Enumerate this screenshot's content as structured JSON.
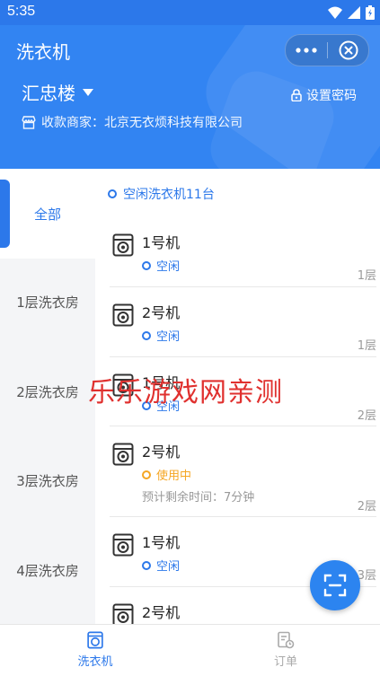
{
  "status_bar": {
    "time": "5:35"
  },
  "header": {
    "title": "洗衣机",
    "building": "汇忠楼",
    "set_password": "设置密码",
    "merchant": "收款商家：北京无衣烦科技有限公司"
  },
  "sidebar": {
    "items": [
      {
        "label": "全部",
        "active": true
      },
      {
        "label": "1层洗衣房"
      },
      {
        "label": "2层洗衣房"
      },
      {
        "label": "3层洗衣房"
      },
      {
        "label": "4层洗衣房"
      }
    ]
  },
  "content": {
    "summary": "空闲洗衣机11台",
    "machines": [
      {
        "name": "1号机",
        "status": "空闲",
        "floor": "1层"
      },
      {
        "name": "2号机",
        "status": "空闲",
        "floor": "1层"
      },
      {
        "name": "1号机",
        "status": "空闲",
        "floor": "2层"
      },
      {
        "name": "2号机",
        "status": "使用中",
        "remain": "预计剩余时间：7分钟",
        "floor": "2层"
      },
      {
        "name": "1号机",
        "status": "空闲",
        "floor": "3层"
      },
      {
        "name": "2号机"
      }
    ]
  },
  "watermark": "乐乐游戏网亲测",
  "tabbar": {
    "items": [
      {
        "label": "洗衣机"
      },
      {
        "label": "订单"
      }
    ]
  },
  "colors": {
    "primary": "#2c78ea",
    "busy": "#f5a623",
    "watermark": "#e0312f"
  },
  "icons": [
    "wifi-icon",
    "signal-icon",
    "battery-icon",
    "more-icon",
    "close-circle-icon",
    "caret-down-icon",
    "lock-icon",
    "store-icon",
    "washing-machine-icon",
    "scan-icon",
    "order-icon"
  ]
}
